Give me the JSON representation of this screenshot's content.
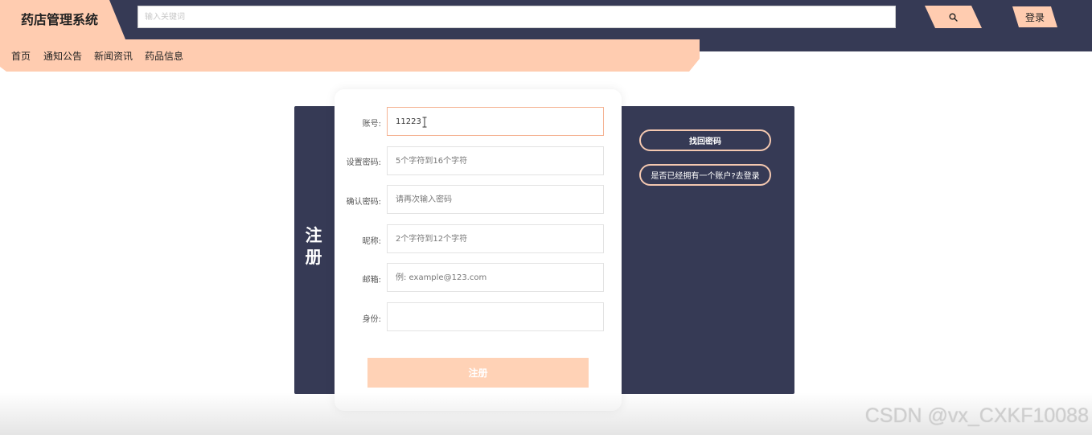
{
  "header": {
    "title": "药店管理系统",
    "search_placeholder": "输入关键词",
    "search_icon": "search-icon",
    "login_label": "登录"
  },
  "nav": {
    "items": [
      {
        "label": "首页"
      },
      {
        "label": "通知公告"
      },
      {
        "label": "新闻资讯"
      },
      {
        "label": "药品信息"
      }
    ]
  },
  "register": {
    "title": "注册",
    "fields": [
      {
        "label": "账号:",
        "value": "11223",
        "placeholder": ""
      },
      {
        "label": "设置密码:",
        "value": "",
        "placeholder": "5个字符到16个字符"
      },
      {
        "label": "确认密码:",
        "value": "",
        "placeholder": "请再次输入密码"
      },
      {
        "label": "昵称:",
        "value": "",
        "placeholder": "2个字符到12个字符"
      },
      {
        "label": "邮箱:",
        "value": "",
        "placeholder": "例: example@123.com"
      },
      {
        "label": "身份:",
        "value": "",
        "placeholder": ""
      }
    ],
    "submit_label": "注册",
    "forgot_password_label": "找回密码",
    "have_account_label": "是否已经拥有一个账户?去登录"
  },
  "watermark": "CSDN @vx_CXKF10088",
  "colors": {
    "navy": "#363a55",
    "peach": "#ffccb0",
    "submit": "#ffd2b6",
    "active_border": "#f5b494"
  }
}
